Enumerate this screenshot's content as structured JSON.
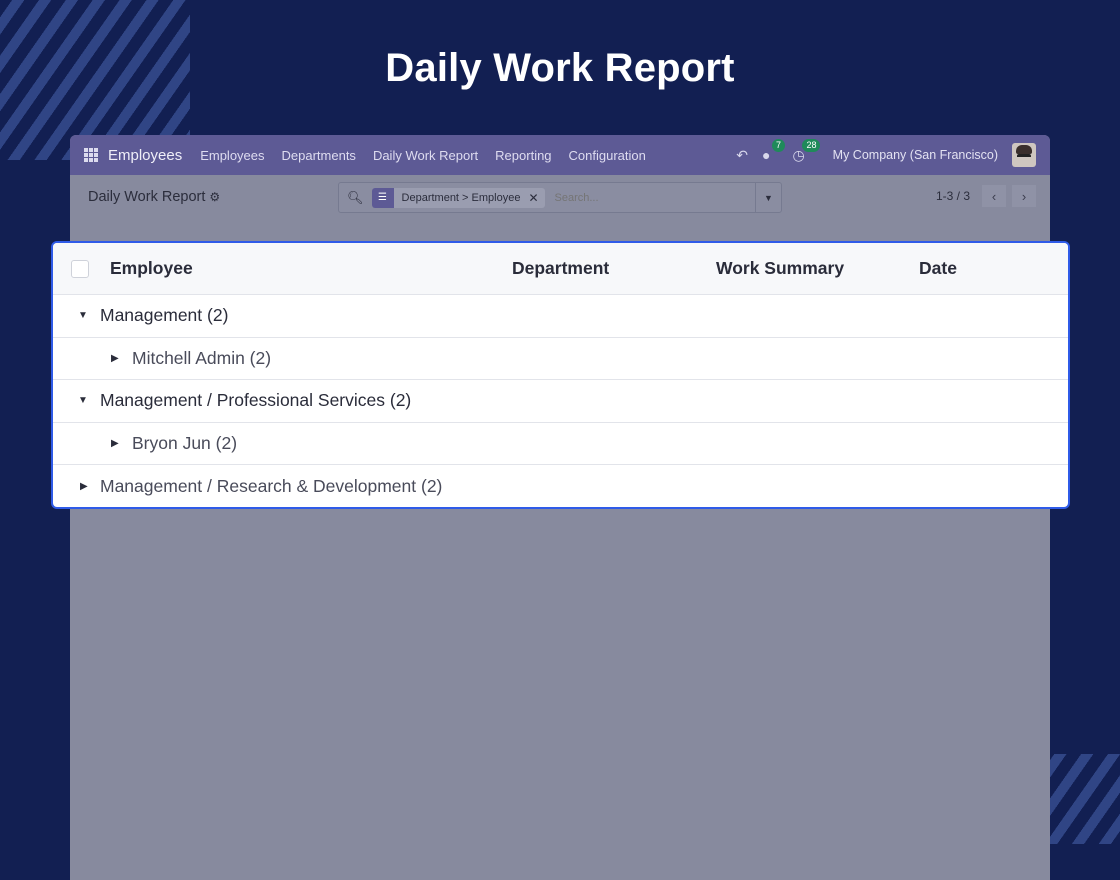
{
  "page_title": "Daily Work Report",
  "navbar": {
    "brand": "Employees",
    "menu": [
      "Employees",
      "Departments",
      "Daily Work Report",
      "Reporting",
      "Configuration"
    ],
    "messages_count": "7",
    "activities_count": "28",
    "company": "My Company (San Francisco)"
  },
  "controlbar": {
    "breadcrumb": "Daily Work Report",
    "facet": "Department > Employee",
    "search_placeholder": "Search...",
    "pager": "1-3 / 3"
  },
  "list": {
    "columns": [
      "Employee",
      "Department",
      "Work Summary",
      "Date"
    ],
    "groups": [
      {
        "label": "Management (2)",
        "level": 0,
        "expanded": true
      },
      {
        "label": "Mitchell Admin (2)",
        "level": 1,
        "expanded": false
      },
      {
        "label": "Management / Professional Services (2)",
        "level": 0,
        "expanded": true
      },
      {
        "label": "Bryon Jun (2)",
        "level": 1,
        "expanded": false
      },
      {
        "label": "Management / Research & Development (2)",
        "level": 0,
        "expanded": false
      }
    ]
  },
  "colors": {
    "background": "#121f52",
    "navbar": "#5d5a95",
    "highlight_border": "#2f5be8"
  }
}
